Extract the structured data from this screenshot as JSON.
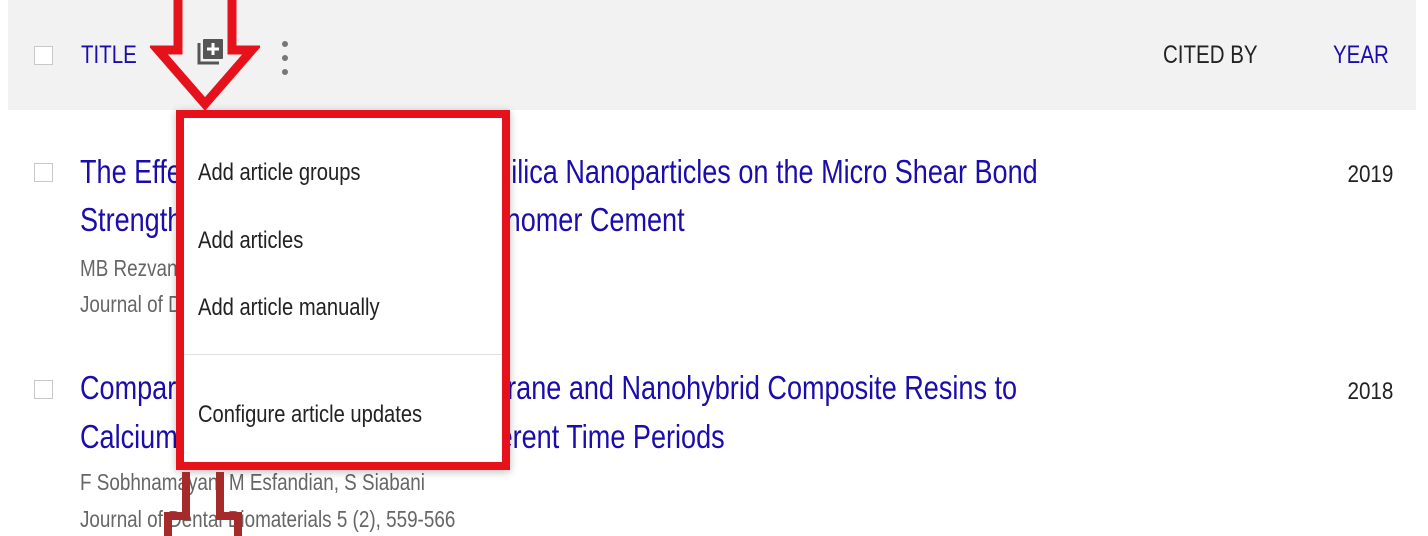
{
  "header": {
    "title_label": "TITLE",
    "cited_by_label": "CITED BY",
    "year_label": "YEAR",
    "add_icon": "add-box-icon",
    "more_icon": "more-vert-icon"
  },
  "articles": [
    {
      "title_line1": "The Effect of Adding 0.5 and 1 wt. Silica Nanoparticles on the Micro Shear Bond",
      "title_line2": "Strength of Resin Modified Glass Ionomer Cement",
      "authors": "MB Rezvani, M Atai, F Koohpeima, S Siabani",
      "journal": "Journal of Dental Biomaterials",
      "year": "2019"
    },
    {
      "title_line1": "Comparison of Microleakage of Silorane and Nanohybrid Composite Resins to",
      "title_line2": "Calcium Silicate Cements after Different Time Periods",
      "authors": "F Sobhnamayan, M Esfandian, S Siabani",
      "journal": "Journal of Dental Biomaterials 5 (2), 559-566",
      "year": "2018"
    }
  ],
  "menu": {
    "items": [
      "Add article groups",
      "Add articles",
      "Add article manually",
      "Configure article updates"
    ]
  },
  "colors": {
    "link": "#1a0dab",
    "annotation_red": "#e5121c",
    "annotation_dark_red": "#a52a2a",
    "header_bg": "#f2f2f2"
  }
}
